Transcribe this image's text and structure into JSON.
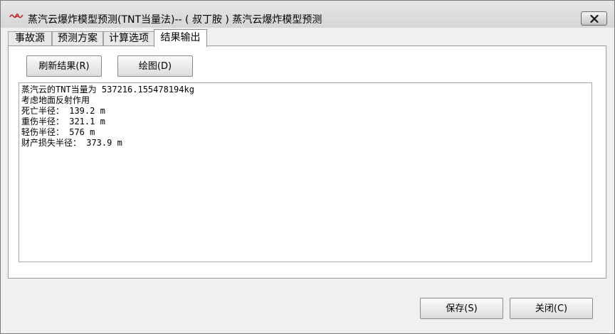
{
  "window": {
    "title": "蒸汽云爆炸模型预测(TNT当量法)-- ( 叔丁胺 ) 蒸汽云爆炸模型预测",
    "app_icon": "app-logo-icon",
    "close_icon": "close-icon"
  },
  "tabs": [
    {
      "label": "事故源",
      "active": false
    },
    {
      "label": "预测方案",
      "active": false
    },
    {
      "label": "计算选项",
      "active": false
    },
    {
      "label": "结果输出",
      "active": true
    }
  ],
  "panel": {
    "refresh_label": "刷新结果(R)",
    "plot_label": "绘图(D)",
    "results": [
      "蒸汽云的TNT当量为 537216.155478194kg",
      "考虑地面反射作用",
      "死亡半径： 139.2 m",
      "重伤半径： 321.1 m",
      "轻伤半径： 576 m",
      "财产损失半径： 373.9 m"
    ]
  },
  "footer": {
    "save_label": "保存(S)",
    "close_label": "关闭(C)"
  }
}
